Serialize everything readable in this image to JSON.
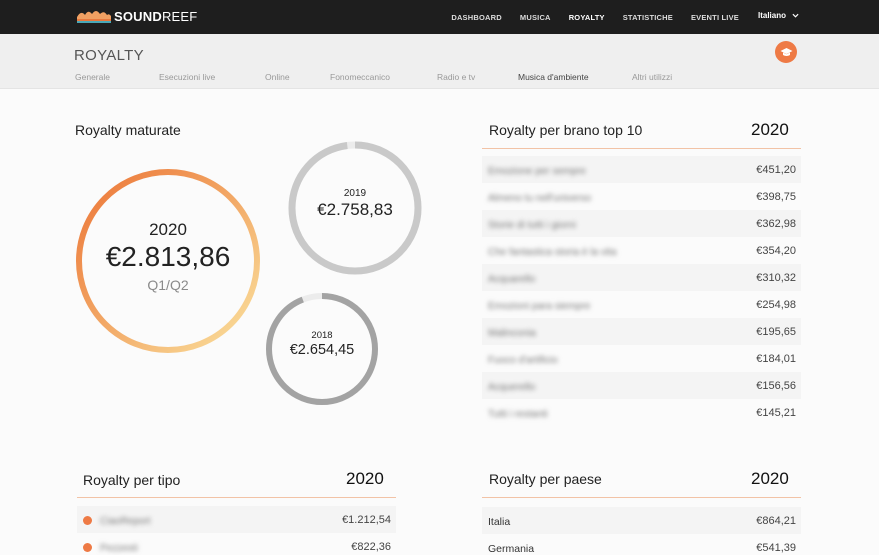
{
  "topbar": {
    "brand_bold": "SOUND",
    "brand_rest": "REEF",
    "nav": [
      {
        "label": "DASHBOARD",
        "active": false
      },
      {
        "label": "MUSICA",
        "active": false
      },
      {
        "label": "ROYALTY",
        "active": true
      },
      {
        "label": "STATISTICHE",
        "active": false
      },
      {
        "label": "EVENTI LIVE",
        "active": false
      }
    ],
    "language": "Italiano"
  },
  "subheader": {
    "title": "ROYALTY",
    "tabs": [
      {
        "label": "Generale",
        "active": false
      },
      {
        "label": "Esecuzioni live",
        "active": false
      },
      {
        "label": "Online",
        "active": false
      },
      {
        "label": "Fonomeccanico",
        "active": false
      },
      {
        "label": "Radio e tv",
        "active": false
      },
      {
        "label": "Musica d'ambiente",
        "active": true
      },
      {
        "label": "Altri utilizzi",
        "active": false
      }
    ],
    "help_icon": "graduation-cap-icon"
  },
  "maturate": {
    "title": "Royalty maturate",
    "main": {
      "year": "2020",
      "amount": "€2.813,86",
      "period": "Q1/Q2",
      "progress": 1.0
    },
    "prev1": {
      "year": "2019",
      "amount": "€2.758,83",
      "progress": 0.98
    },
    "prev2": {
      "year": "2018",
      "amount": "€2.654,45",
      "progress": 0.94
    }
  },
  "top10": {
    "title": "Royalty per brano top 10",
    "year": "2020",
    "rows": [
      {
        "name": "Emozione per sempre",
        "value": "€451,20"
      },
      {
        "name": "Almeno tu nell'universo",
        "value": "€398,75"
      },
      {
        "name": "Storie di tutti i giorni",
        "value": "€362,98"
      },
      {
        "name": "Che fantastica storia è la vita",
        "value": "€354,20"
      },
      {
        "name": "Acquarello",
        "value": "€310,32"
      },
      {
        "name": "Emozioni para siempre",
        "value": "€254,98"
      },
      {
        "name": "Malinconia",
        "value": "€195,65"
      },
      {
        "name": "Fuoco d'artificio",
        "value": "€184,01"
      },
      {
        "name": "Acquerello",
        "value": "€156,56"
      },
      {
        "name": "Tutti i restanti",
        "value": "€145,21"
      }
    ]
  },
  "tipo": {
    "title": "Royalty per tipo",
    "year": "2020",
    "rows": [
      {
        "name": "CiaoReport",
        "value": "€1.212,54"
      },
      {
        "name": "Pezzesti",
        "value": "€822,36"
      }
    ]
  },
  "paese": {
    "title": "Royalty per paese",
    "year": "2020",
    "rows": [
      {
        "name": "Italia",
        "value": "€864,21"
      },
      {
        "name": "Germania",
        "value": "€541,39"
      }
    ]
  },
  "colors": {
    "accent": "#ee7a45",
    "dark": "#1e1e1e"
  }
}
